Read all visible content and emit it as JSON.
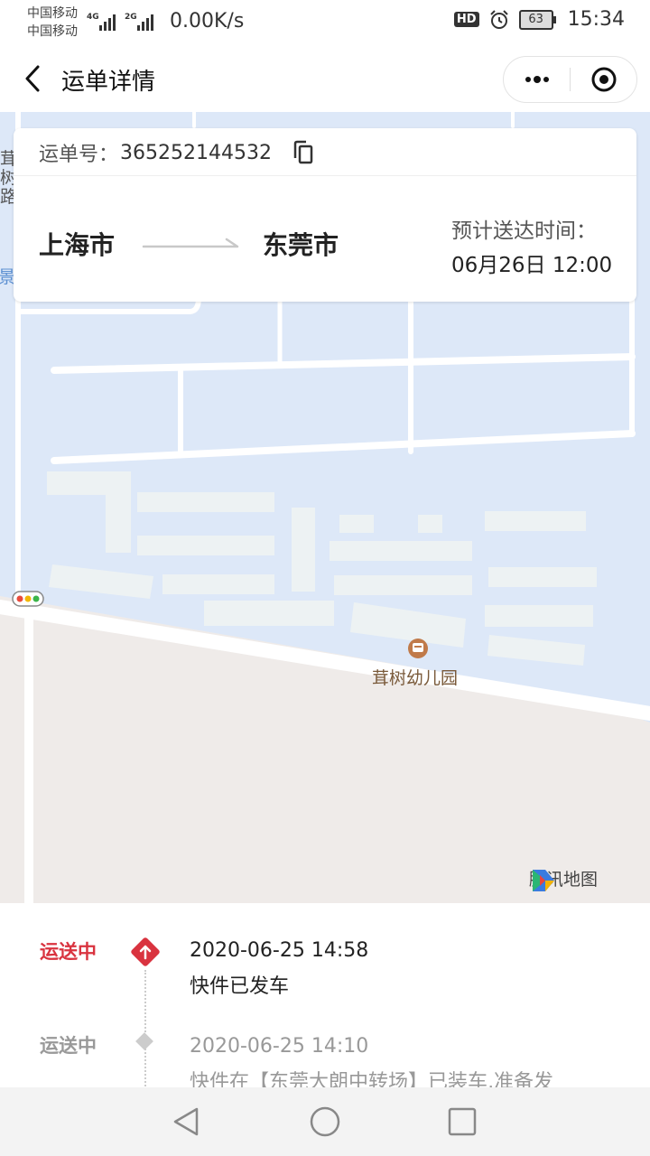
{
  "status_bar": {
    "carrier1": "中国移动",
    "carrier2": "中国移动",
    "net1": "4G",
    "net2": "2G",
    "speed": "0.00K/s",
    "hd": "HD",
    "battery": "63",
    "time": "15:34"
  },
  "navbar": {
    "title": "运单详情"
  },
  "card": {
    "waybill_label": "运单号：",
    "waybill_no": "365252144532",
    "from_city": "上海市",
    "to_city": "东莞市",
    "eta_label": "预计送达时间：",
    "eta_value": "06月26日 12:00"
  },
  "map": {
    "poi_name": "茸树幼儿园",
    "road_left": "茸树路",
    "edge_label": "景",
    "attribution": "腾讯地图"
  },
  "timeline": [
    {
      "status": "运送中",
      "time": "2020-06-25 14:58",
      "desc": "快件已发车",
      "active": true
    },
    {
      "status": "运送中",
      "time": "2020-06-25 14:10",
      "desc": "快件在【东莞大朗中转场】已装车,准备发",
      "active": false
    }
  ],
  "colors": {
    "accent": "#d9333f",
    "map_block": "#dde8f8",
    "map_bg": "#efebe9",
    "muted": "#999999"
  }
}
